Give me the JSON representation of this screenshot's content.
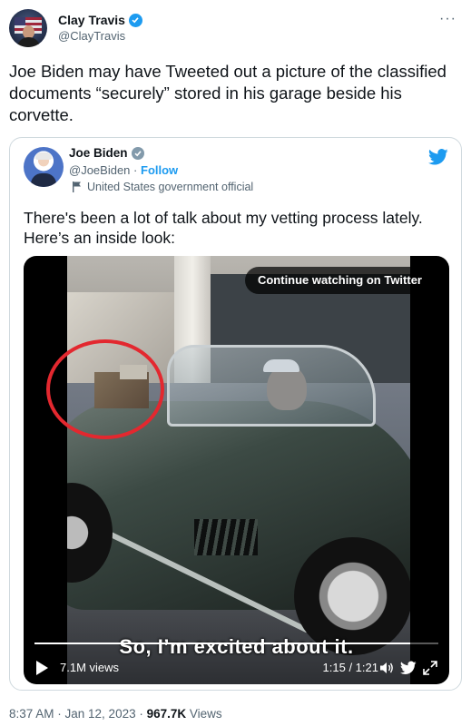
{
  "author": {
    "name": "Clay Travis",
    "handle": "@ClayTravis"
  },
  "tweet": {
    "text": "Joe Biden may have Tweeted out a picture of the classified documents “securely” stored in his garage beside his corvette."
  },
  "quoted": {
    "name": "Joe Biden",
    "handle": "@JoeBiden",
    "separator": "·",
    "follow_label": "Follow",
    "account_label": "United States government official",
    "text": "There's been a lot of talk about my vetting process lately. Here’s an inside look:"
  },
  "video": {
    "continue_label": "Continue watching on Twitter",
    "subtitle": "So, I’m excited about it.",
    "views": "7.1M views",
    "time": "1:15 / 1:21",
    "progress": 0.93
  },
  "meta": {
    "timestamp": "8:37 AM · Jan 12, 2023 · ",
    "views_count": "967.7K",
    "views_label": " Views"
  },
  "colors": {
    "accent": "#1d9bf0",
    "muted": "#536471",
    "highlight_circle": "#e3282f"
  },
  "icons": [
    "verified-badge-icon",
    "more-icon",
    "twitter-bird-icon",
    "flag-icon",
    "play-icon",
    "volume-icon",
    "expand-icon"
  ]
}
